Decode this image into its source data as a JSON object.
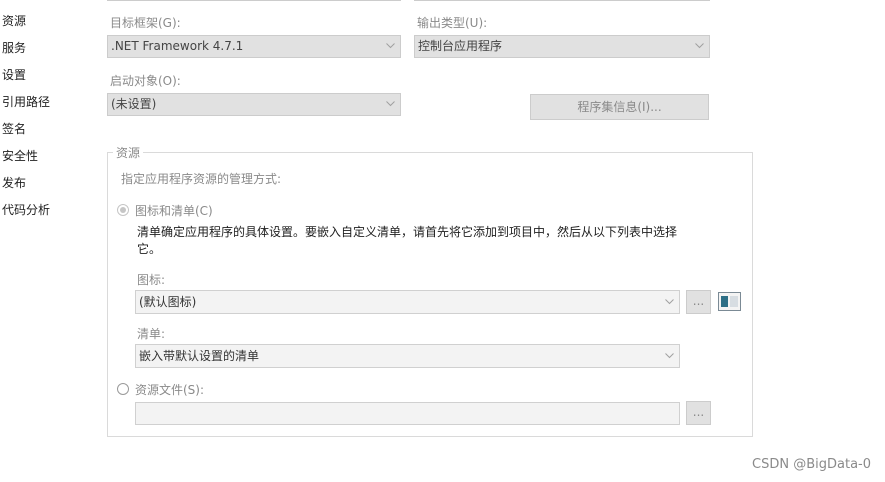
{
  "sidebar": {
    "items": [
      {
        "label": "资源"
      },
      {
        "label": "服务"
      },
      {
        "label": "设置"
      },
      {
        "label": "引用路径"
      },
      {
        "label": "签名"
      },
      {
        "label": "安全性"
      },
      {
        "label": "发布"
      },
      {
        "label": "代码分析"
      }
    ]
  },
  "app": {
    "target_framework": {
      "label": "目标框架(G):",
      "value": ".NET Framework 4.7.1"
    },
    "output_type": {
      "label": "输出类型(U):",
      "value": "控制台应用程序"
    },
    "startup_object": {
      "label": "启动对象(O):",
      "value": "(未设置)"
    },
    "assembly_info_button": "程序集信息(I)..."
  },
  "resources": {
    "group_title": "资源",
    "instruction": "指定应用程序资源的管理方式:",
    "icon_manifest_radio": {
      "label": "图标和清单(C)",
      "checked": true
    },
    "description_line1": "清单确定应用程序的具体设置。要嵌入自定义清单，请首先将它添加到项目中，然后从以下列表中选择",
    "description_line2": "它。",
    "icon": {
      "label": "图标:",
      "value": "(默认图标)",
      "browse": "..."
    },
    "manifest": {
      "label": "清单:",
      "value": "嵌入带默认设置的清单"
    },
    "resource_file_radio": {
      "label": "资源文件(S):",
      "checked": false
    },
    "resource_file": {
      "value": "",
      "browse": "..."
    }
  },
  "watermark": "CSDN @BigData-0"
}
